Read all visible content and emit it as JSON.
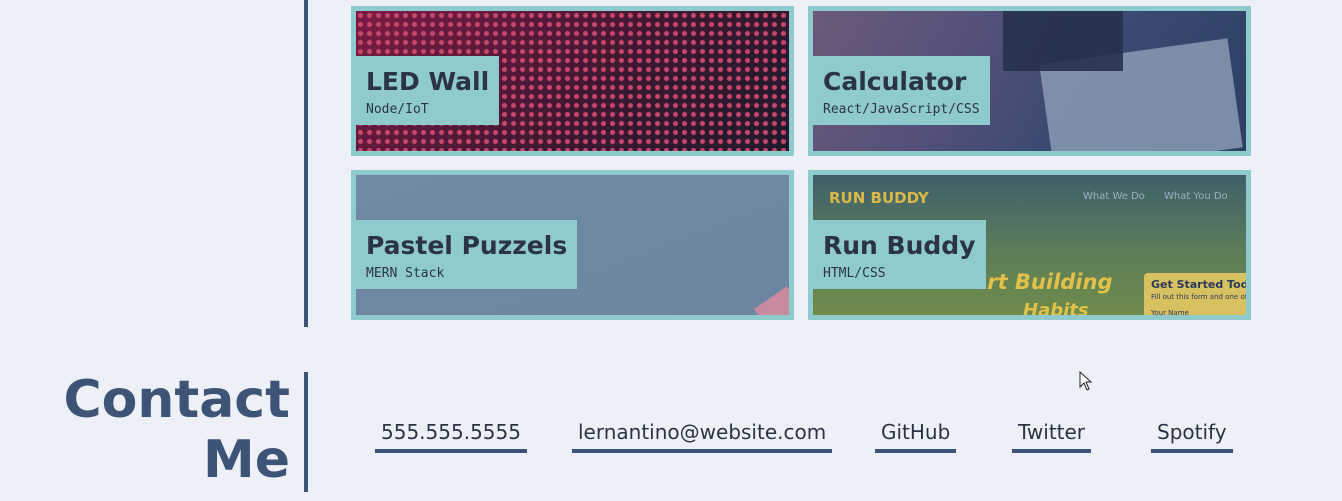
{
  "projects": [
    {
      "title": "LED Wall",
      "subtitle": "Node/IoT"
    },
    {
      "title": "Calculator",
      "subtitle": "React/JavaScript/CSS"
    },
    {
      "title": "Pastel Puzzels",
      "subtitle": "MERN Stack"
    },
    {
      "title": "Run Buddy",
      "subtitle": "HTML/CSS"
    }
  ],
  "contact": {
    "heading_line1": "Contact",
    "heading_line2": "Me",
    "links": [
      "555.555.5555",
      "lernantino@website.com",
      "GitHub",
      "Twitter",
      "Spotify"
    ]
  },
  "colors": {
    "accent": "#8fcacc",
    "navy": "#3d5476",
    "background": "#eef0f7"
  }
}
